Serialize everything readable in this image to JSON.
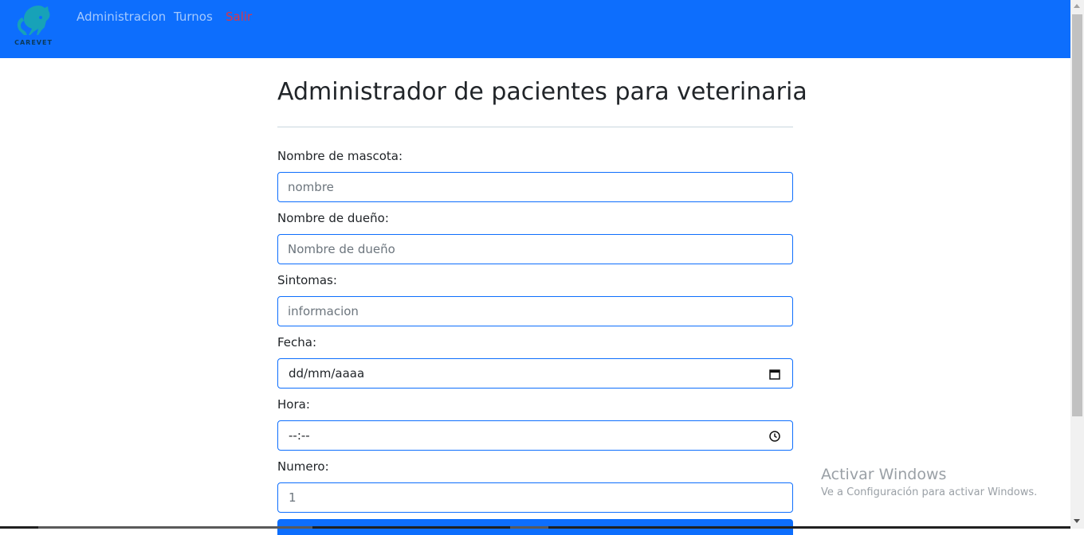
{
  "app": {
    "brand": "CAREVET"
  },
  "nav": {
    "links": [
      {
        "label": "Administracion"
      },
      {
        "label": "Turnos"
      },
      {
        "label": "Salir"
      }
    ]
  },
  "page": {
    "title": "Administrador de pacientes para veterinaria"
  },
  "form": {
    "pet_name": {
      "label": "Nombre de mascota:",
      "placeholder": "nombre",
      "value": ""
    },
    "owner_name": {
      "label": "Nombre de dueño:",
      "placeholder": "Nombre de dueño",
      "value": ""
    },
    "symptoms": {
      "label": "Sintomas:",
      "placeholder": "informacion",
      "value": ""
    },
    "date": {
      "label": "Fecha:",
      "display": "dd/mm/aaaa",
      "icon": "calendar-icon"
    },
    "time": {
      "label": "Hora:",
      "display": "--:--",
      "icon": "clock-icon"
    },
    "number": {
      "label": "Numero:",
      "value": "1"
    }
  },
  "watermark": {
    "title": "Activar Windows",
    "subtitle": "Ve a Configuración para activar Windows."
  },
  "colors": {
    "primary": "#0d6efd",
    "danger": "#dc3545",
    "logo": "#17a2b8"
  }
}
